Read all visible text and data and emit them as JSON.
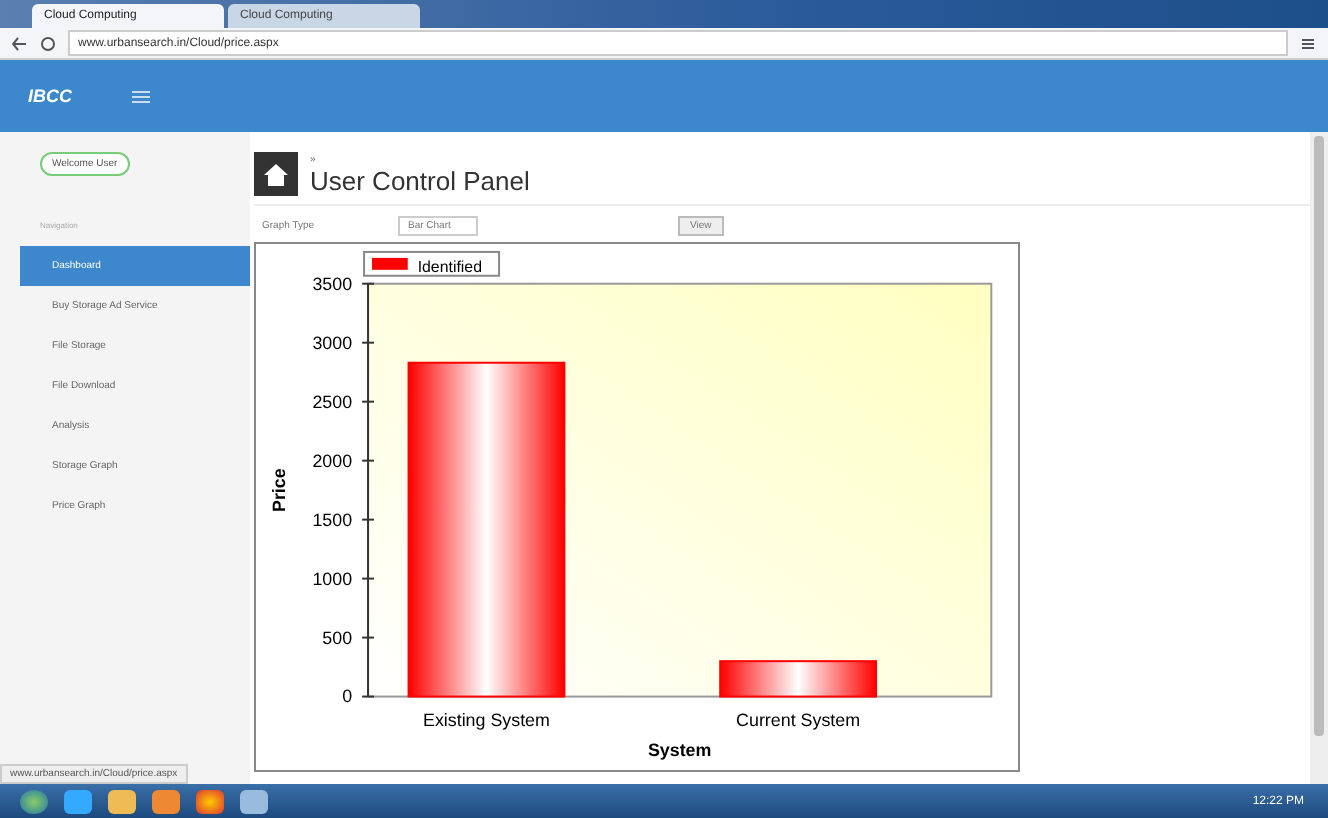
{
  "browser": {
    "tabs": [
      {
        "label": "Cloud Computing",
        "selected": true
      },
      {
        "label": "Cloud Computing",
        "selected": false
      }
    ],
    "url": "www.urbansearch.in/Cloud/price.aspx"
  },
  "header": {
    "brand": "IBCC"
  },
  "sidebar": {
    "user_button": "Welcome User",
    "section": "Navigation",
    "items": [
      {
        "label": "Dashboard",
        "selected": true
      },
      {
        "label": "Buy Storage Ad Service",
        "selected": false
      },
      {
        "label": "File Storage",
        "selected": false
      },
      {
        "label": "File Download",
        "selected": false
      },
      {
        "label": "Analysis",
        "selected": false
      },
      {
        "label": "Storage Graph",
        "selected": false
      },
      {
        "label": "Price Graph",
        "selected": false
      }
    ]
  },
  "page": {
    "breadcrumb": "»",
    "title": "User Control Panel",
    "graph_type_label": "Graph Type",
    "graph_type": "Bar Chart",
    "view_button": "View",
    "chart_data": {
      "type": "bar",
      "xlabel": "System",
      "ylabel": "Price",
      "categories": [
        "Existing System",
        "Current System"
      ],
      "series": [
        {
          "name": "Identified",
          "color": "#ff0000",
          "values": [
            2830,
            300
          ]
        }
      ],
      "ylim": [
        0,
        3500
      ],
      "yticks": [
        0,
        500,
        1000,
        1500,
        2000,
        2500,
        3000,
        3500
      ]
    }
  },
  "status_bar": "www.urbansearch.in/Cloud/price.aspx",
  "taskbar": {
    "clock": "12:22 PM"
  }
}
